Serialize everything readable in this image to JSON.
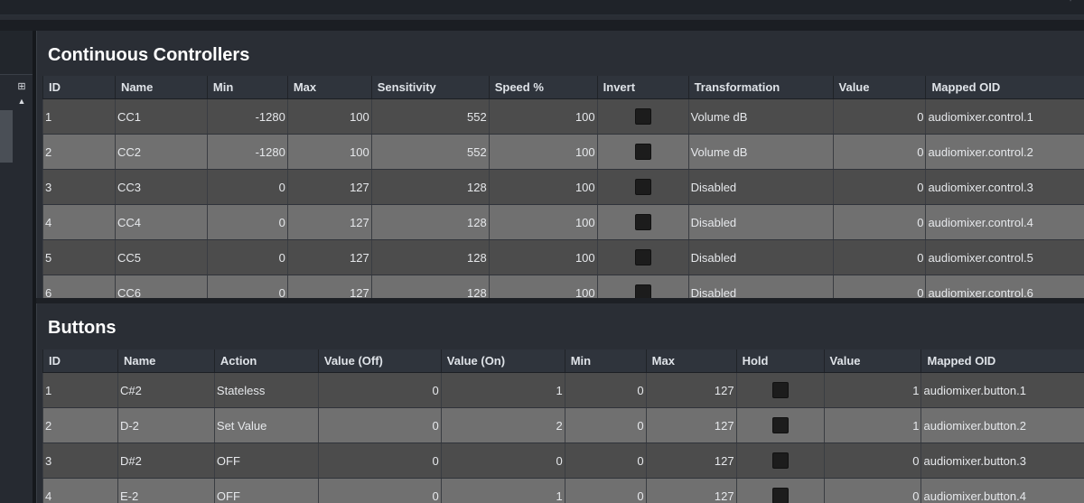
{
  "window": {
    "corner_mark": "'"
  },
  "left_panel": {
    "tool_a_icon": "panel-toggle-icon",
    "tool_b_icon": "arrow-up-icon"
  },
  "cc_section": {
    "title": "Continuous Controllers",
    "columns": [
      "ID",
      "Name",
      "Min",
      "Max",
      "Sensitivity",
      "Speed %",
      "Invert",
      "Transformation",
      "Value",
      "Mapped OID"
    ],
    "rows": [
      {
        "id": "1",
        "name": "CC1",
        "min": "-1280",
        "max": "100",
        "sensitivity": "552",
        "speed": "100",
        "invert": false,
        "transformation": "Volume dB",
        "value": "0",
        "oid": "audiomixer.control.1"
      },
      {
        "id": "2",
        "name": "CC2",
        "min": "-1280",
        "max": "100",
        "sensitivity": "552",
        "speed": "100",
        "invert": false,
        "transformation": "Volume dB",
        "value": "0",
        "oid": "audiomixer.control.2"
      },
      {
        "id": "3",
        "name": "CC3",
        "min": "0",
        "max": "127",
        "sensitivity": "128",
        "speed": "100",
        "invert": false,
        "transformation": "Disabled",
        "value": "0",
        "oid": "audiomixer.control.3"
      },
      {
        "id": "4",
        "name": "CC4",
        "min": "0",
        "max": "127",
        "sensitivity": "128",
        "speed": "100",
        "invert": false,
        "transformation": "Disabled",
        "value": "0",
        "oid": "audiomixer.control.4"
      },
      {
        "id": "5",
        "name": "CC5",
        "min": "0",
        "max": "127",
        "sensitivity": "128",
        "speed": "100",
        "invert": false,
        "transformation": "Disabled",
        "value": "0",
        "oid": "audiomixer.control.5"
      },
      {
        "id": "6",
        "name": "CC6",
        "min": "0",
        "max": "127",
        "sensitivity": "128",
        "speed": "100",
        "invert": false,
        "transformation": "Disabled",
        "value": "0",
        "oid": "audiomixer.control.6"
      }
    ]
  },
  "buttons_section": {
    "title": "Buttons",
    "columns": [
      "ID",
      "Name",
      "Action",
      "Value (Off)",
      "Value (On)",
      "Min",
      "Max",
      "Hold",
      "Value",
      "Mapped OID"
    ],
    "rows": [
      {
        "id": "1",
        "name": "C#2",
        "action": "Stateless",
        "off": "0",
        "on": "1",
        "min": "0",
        "max": "127",
        "hold": false,
        "value": "1",
        "oid": "audiomixer.button.1"
      },
      {
        "id": "2",
        "name": "D-2",
        "action": "Set Value",
        "off": "0",
        "on": "2",
        "min": "0",
        "max": "127",
        "hold": false,
        "value": "1",
        "oid": "audiomixer.button.2"
      },
      {
        "id": "3",
        "name": "D#2",
        "action": "OFF",
        "off": "0",
        "on": "0",
        "min": "0",
        "max": "127",
        "hold": false,
        "value": "0",
        "oid": "audiomixer.button.3"
      },
      {
        "id": "4",
        "name": "E-2",
        "action": "OFF",
        "off": "0",
        "on": "1",
        "min": "0",
        "max": "127",
        "hold": false,
        "value": "0",
        "oid": "audiomixer.button.4"
      }
    ]
  }
}
